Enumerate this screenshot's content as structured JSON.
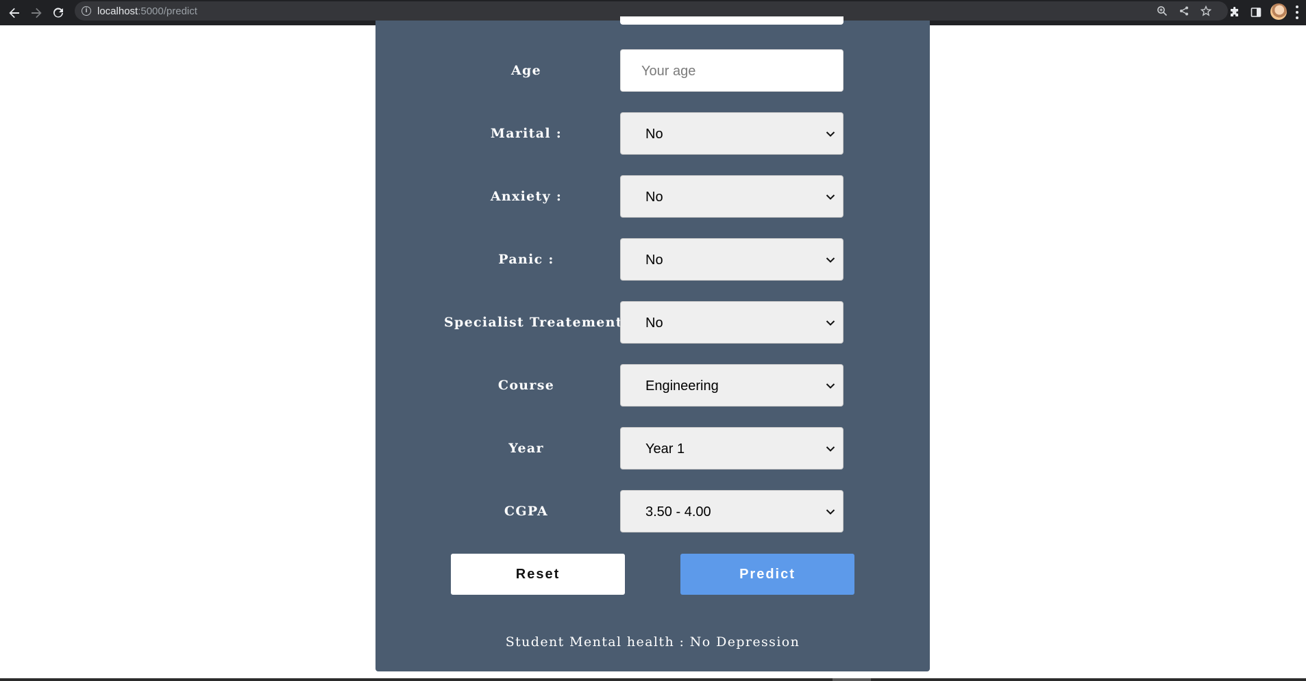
{
  "browser": {
    "url_host": "localhost",
    "url_path": ":5000/predict",
    "icons": {
      "back": "back-arrow-icon",
      "forward": "forward-arrow-icon",
      "reload": "reload-icon",
      "site_info": "info-icon",
      "zoom": "zoom-icon",
      "share": "share-icon",
      "bookmark": "star-icon",
      "extensions": "puzzle-icon",
      "side_panel": "side-panel-icon",
      "profile": "avatar",
      "menu": "kebab-menu-icon"
    }
  },
  "form": {
    "background_color": "#4b5c70",
    "fields": [
      {
        "label": "Age",
        "type": "input",
        "value": "",
        "placeholder": "Your age"
      },
      {
        "label": "Marital :",
        "type": "select",
        "value": "No"
      },
      {
        "label": "Anxiety :",
        "type": "select",
        "value": "No"
      },
      {
        "label": "Panic :",
        "type": "select",
        "value": "No"
      },
      {
        "label": "Specialist Treatement :",
        "type": "select",
        "value": "No"
      },
      {
        "label": "Course",
        "type": "select",
        "value": "Engineering"
      },
      {
        "label": "Year",
        "type": "select",
        "value": "Year 1"
      },
      {
        "label": "CGPA",
        "type": "select",
        "value": "3.50 - 4.00"
      }
    ],
    "buttons": {
      "reset_label": "Reset",
      "predict_label": "Predict",
      "predict_color": "#5d9aea"
    },
    "result_text": "Student Mental health : No Depression"
  }
}
